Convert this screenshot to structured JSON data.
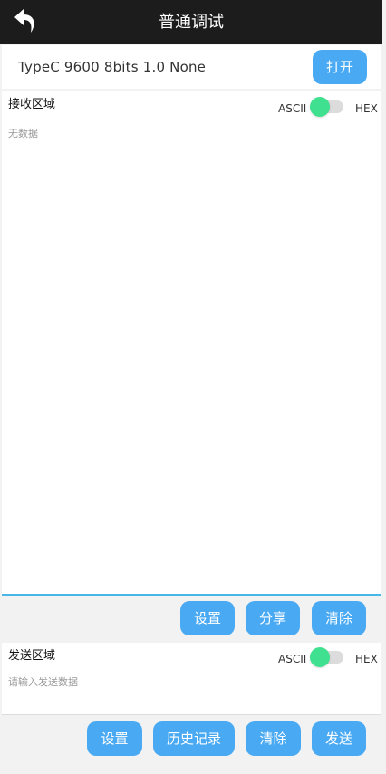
{
  "header": {
    "title": "普通调试",
    "back_icon": "back-arrow-icon"
  },
  "port": {
    "info": "TypeC  9600  8bits  1.0  None",
    "open_label": "打开"
  },
  "receive": {
    "title": "接收区域",
    "mode_ascii": "ASCII",
    "mode_hex": "HEX",
    "placeholder": "无数据",
    "buttons": {
      "settings": "设置",
      "share": "分享",
      "clear": "清除"
    }
  },
  "send": {
    "title": "发送区域",
    "mode_ascii": "ASCII",
    "mode_hex": "HEX",
    "placeholder": "请输入发送数据",
    "buttons": {
      "settings": "设置",
      "history": "历史记录",
      "clear": "清除",
      "send": "发送"
    }
  },
  "colors": {
    "accent": "#49a9f3",
    "toggle_on": "#3fe08f",
    "header_bg": "#1c1c1c"
  }
}
